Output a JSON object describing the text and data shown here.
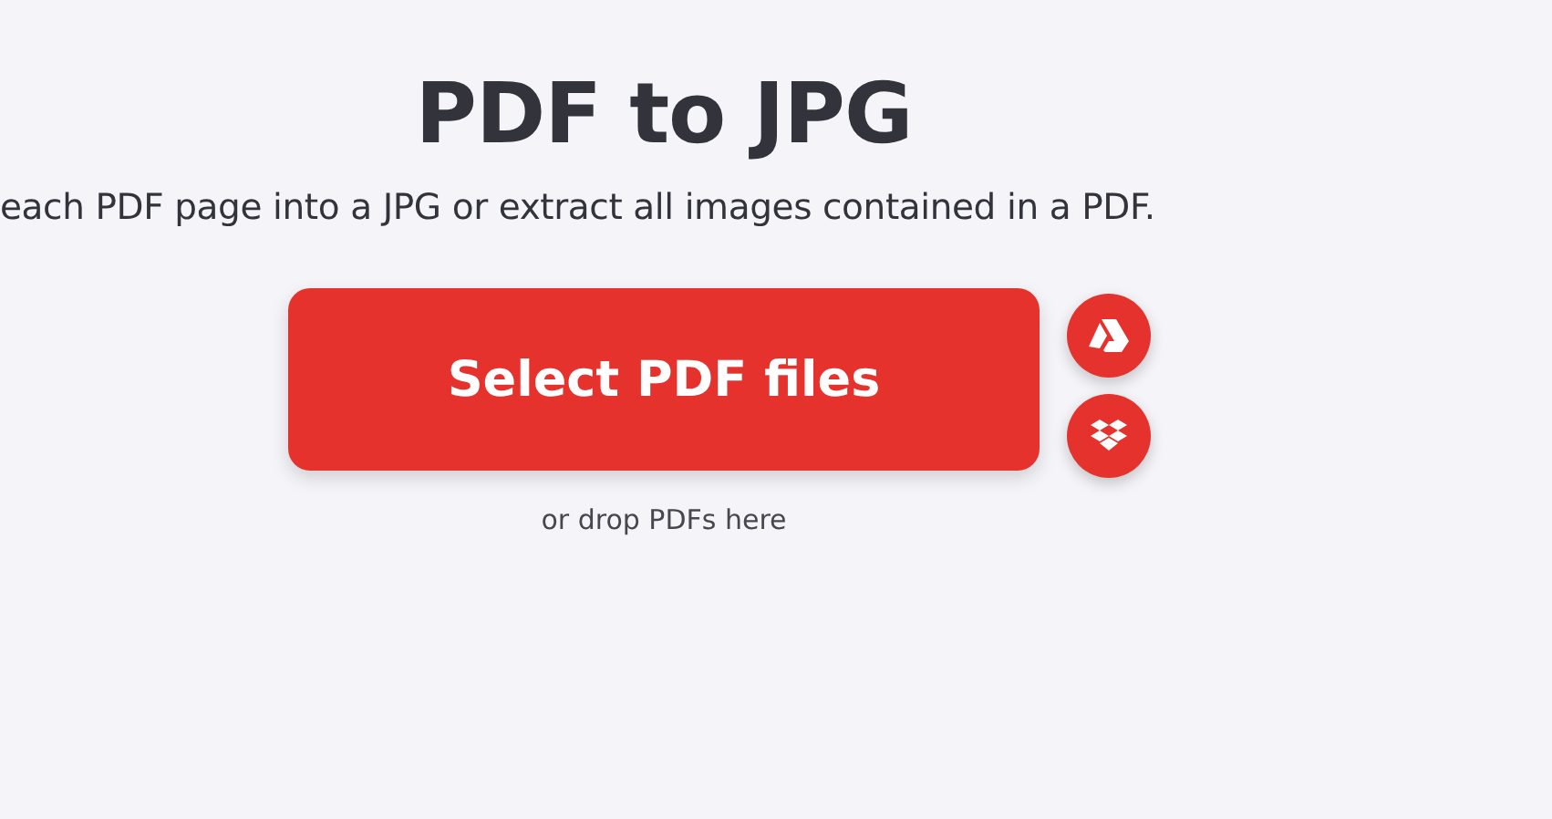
{
  "title": "PDF to JPG",
  "subtitle": "each PDF page into a JPG or extract all images contained in a PDF.",
  "select_button": "Select PDF files",
  "drop_hint": "or drop PDFs here"
}
